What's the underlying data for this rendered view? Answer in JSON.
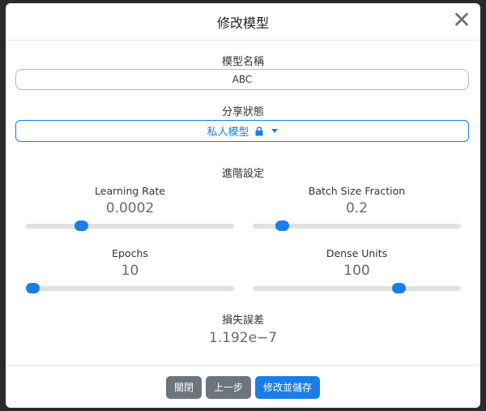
{
  "modal": {
    "title": "修改模型",
    "close_icon": "✕"
  },
  "model_name": {
    "label": "模型名稱",
    "value": "ABC"
  },
  "share": {
    "label": "分享狀態",
    "selected": "私人模型",
    "icon": "lock-icon"
  },
  "advanced": {
    "label": "進階設定",
    "learning_rate": {
      "label": "Learning Rate",
      "value": "0.0002",
      "fill": 0.265
    },
    "batch_size_fraction": {
      "label": "Batch Size Fraction",
      "value": "0.2",
      "fill": 0.14
    },
    "epochs": {
      "label": "Epochs",
      "value": "10",
      "fill": 0.03
    },
    "dense_units": {
      "label": "Dense Units",
      "value": "100",
      "fill": 0.7
    }
  },
  "loss": {
    "label": "損失誤差",
    "value": "1.192e−7"
  },
  "footer": {
    "close_label": "關閉",
    "prev_label": "上一步",
    "save_label": "修改並儲存"
  },
  "colors": {
    "accent": "#1a7ee6",
    "secondary": "#6c757d"
  }
}
